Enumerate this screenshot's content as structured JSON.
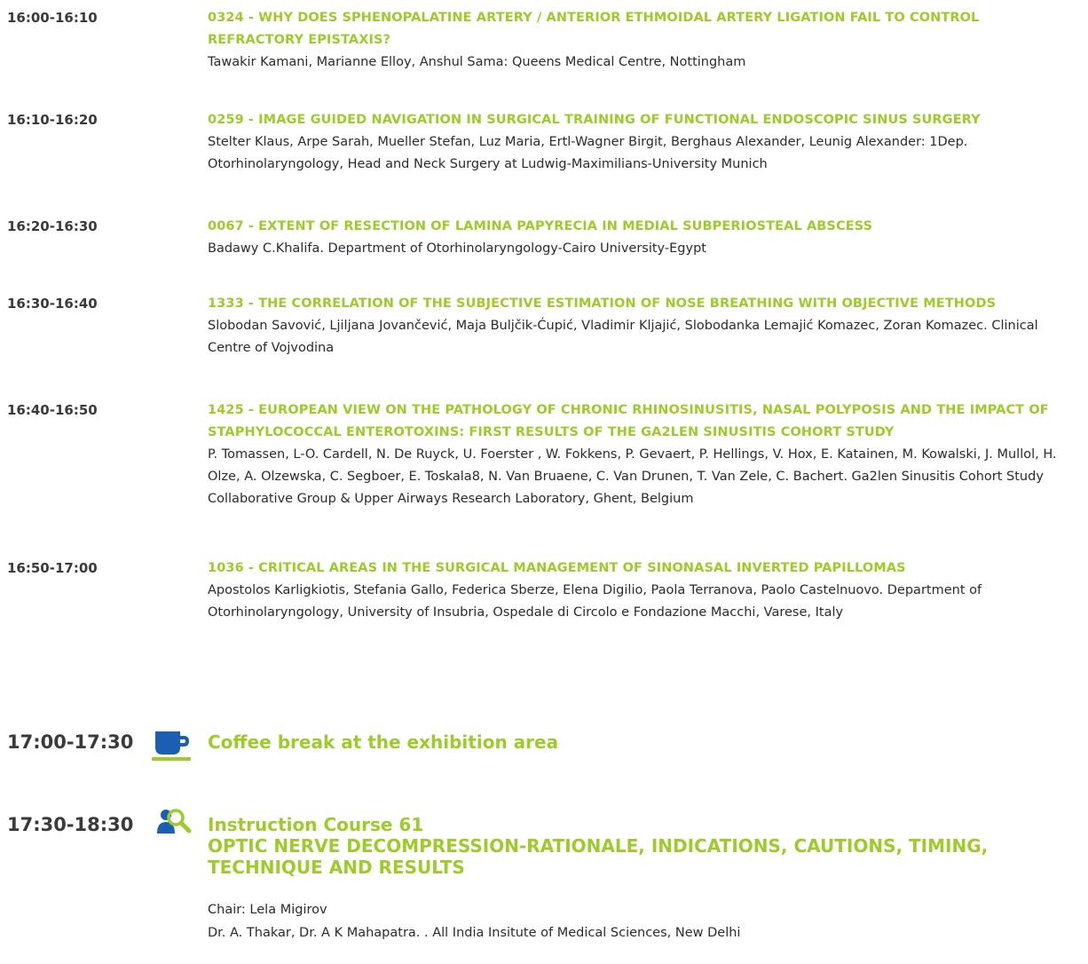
{
  "entries": [
    {
      "time": "16:00-16:10",
      "title": "0324 - WHY DOES SPHENOPALATINE ARTERY / ANTERIOR ETHMOIDAL ARTERY LIGATION FAIL TO CONTROL REFRACTORY EPISTAXIS?",
      "authors": "Tawakir Kamani, Marianne Elloy, Anshul Sama: Queens Medical Centre, Nottingham"
    },
    {
      "time": "16:10-16:20",
      "title": "0259 - IMAGE GUIDED NAVIGATION IN SURGICAL TRAINING OF FUNCTIONAL ENDOSCOPIC SINUS SURGERY",
      "authors": "Stelter Klaus, Arpe Sarah, Mueller Stefan, Luz Maria, Ertl-Wagner Birgit, Berghaus Alexander, Leunig Alexander: 1Dep. Otorhinolaryngology, Head and Neck Surgery at Ludwig-Maximilians-University Munich"
    },
    {
      "time": "16:20-16:30",
      "title": "0067 - EXTENT OF RESECTION OF LAMINA PAPYRECIA IN MEDIAL SUBPERIOSTEAL ABSCESS",
      "authors": "Badawy C.Khalifa. Department of Otorhinolaryngology-Cairo University-Egypt"
    },
    {
      "time": "16:30-16:40",
      "title": "1333 - THE CORRELATION OF THE SUBJECTIVE ESTIMATION OF NOSE BREATHING WITH OBJECTIVE METHODS",
      "authors": "Slobodan Savović, Ljiljana Jovančević, Maja Buljčik-Ćupić, Vladimir Kljajić, Slobodanka Lemajić Komazec, Zoran Komazec. Clinical Centre of Vojvodina"
    },
    {
      "time": "16:40-16:50",
      "title": "1425 - EUROPEAN VIEW ON THE PATHOLOGY OF CHRONIC RHINOSINUSITIS, NASAL POLYPOSIS AND THE IMPACT OF STAPHYLOCOCCAL ENTEROTOXINS: FIRST RESULTS OF THE GA2LEN SINUSITIS COHORT STUDY",
      "authors": "P. Tomassen, L-O. Cardell, N. De Ruyck, U. Foerster , W. Fokkens, P. Gevaert, P. Hellings, V. Hox, E. Katainen, M. Kowalski, J. Mullol, H. Olze, A. Olzewska, C. Segboer, E. Toskala8, N. Van Bruaene, C. Van Drunen, T. Van Zele, C. Bachert. Ga2len Sinusitis Cohort Study Collaborative Group & Upper Airways Research Laboratory, Ghent, Belgium"
    },
    {
      "time": "16:50-17:00",
      "title": "1036 - CRITICAL AREAS IN THE SURGICAL MANAGEMENT OF SINONASAL INVERTED PAPILLOMAS",
      "authors": "Apostolos Karligkiotis, Stefania Gallo, Federica Sberze, Elena Digilio, Paola Terranova, Paolo Castelnuovo. Department of Otorhinolaryngology, University of Insubria, Ospedale di Circolo e Fondazione Macchi, Varese, Italy"
    }
  ],
  "coffee": {
    "time": "17:00-17:30",
    "icon": "coffee-cup-icon",
    "title": "Coffee break at the exhibition area"
  },
  "course": {
    "time": "17:30-18:30",
    "icon": "instruction-course-icon",
    "title": "Instruction Course 61",
    "subtitle": "OPTIC NERVE DECOMPRESSION-RATIONALE, INDICATIONS, CAUTIONS, TIMING, TECHNIQUE AND RESULTS",
    "chair": "Chair: Lela Migirov",
    "speakers": "Dr. A. Thakar, Dr. A K Mahapatra. . All India Insitute of Medical Sciences, New Delhi"
  },
  "colors": {
    "accent": "#9ccb2a",
    "coffee_icon": "#1a5fb4",
    "text": "#2b2b2b"
  }
}
